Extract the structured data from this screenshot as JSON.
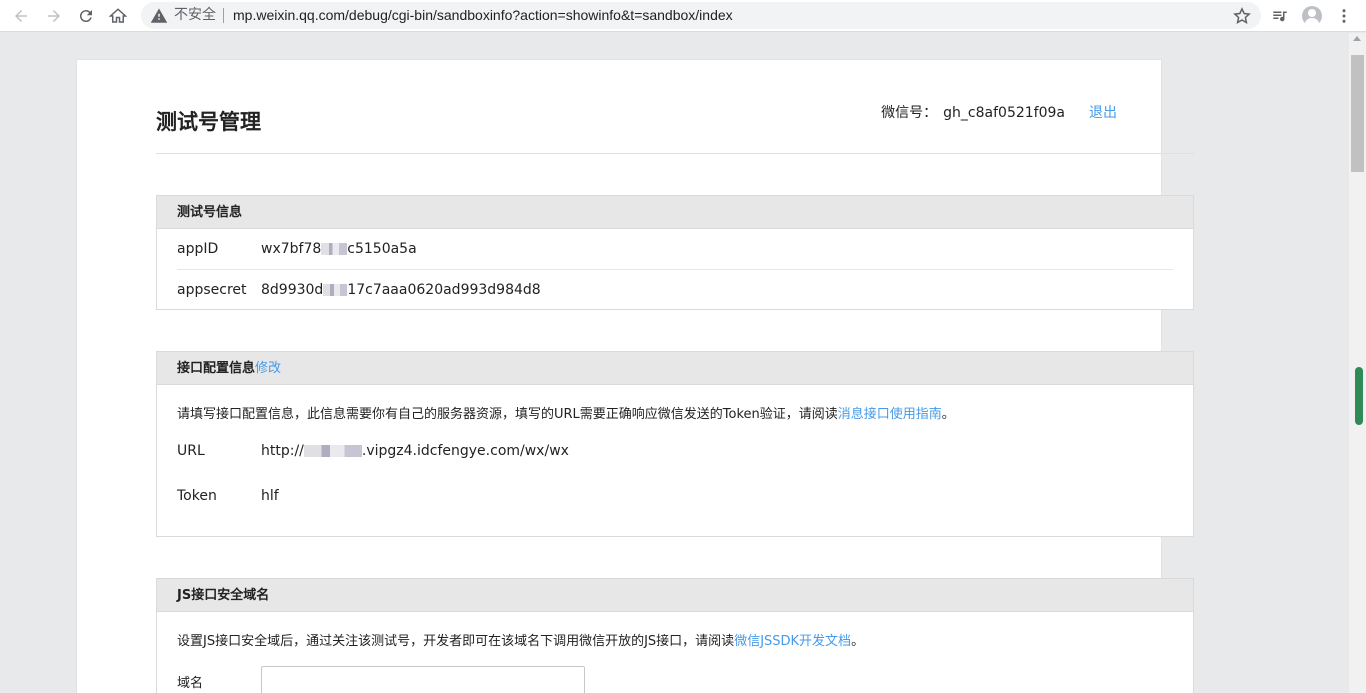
{
  "browser": {
    "insecure_label": "不安全",
    "url": "mp.weixin.qq.com/debug/cgi-bin/sandboxinfo?action=showinfo&t=sandbox/index"
  },
  "header": {
    "title": "测试号管理",
    "wx_label": "微信号：",
    "wx_id": "gh_c8af0521f09a",
    "logout": "退出"
  },
  "test_account": {
    "heading": "测试号信息",
    "appid_label": "appID",
    "appid_prefix": "wx7bf78",
    "appid_suffix": "c5150a5a",
    "appsecret_label": "appsecret",
    "appsecret_prefix": "8d9930d",
    "appsecret_suffix": "17c7aaa0620ad993d984d8"
  },
  "interface_config": {
    "heading": "接口配置信息",
    "edit_link": "修改",
    "description": "请填写接口配置信息，此信息需要你有自己的服务器资源，填写的URL需要正确响应微信发送的Token验证，请阅读",
    "guide_link": "消息接口使用指南",
    "period": "。",
    "url_label": "URL",
    "url_prefix": "http://",
    "url_suffix": ".vipgz4.idcfengye.com/wx/wx",
    "token_label": "Token",
    "token_value": "hlf"
  },
  "js_domain": {
    "heading": "JS接口安全域名",
    "description": "设置JS接口安全域后，通过关注该测试号，开发者即可在该域名下调用微信开放的JS接口，请阅读",
    "doc_link": "微信JSSDK开发文档",
    "period": "。",
    "domain_label": "域名"
  }
}
